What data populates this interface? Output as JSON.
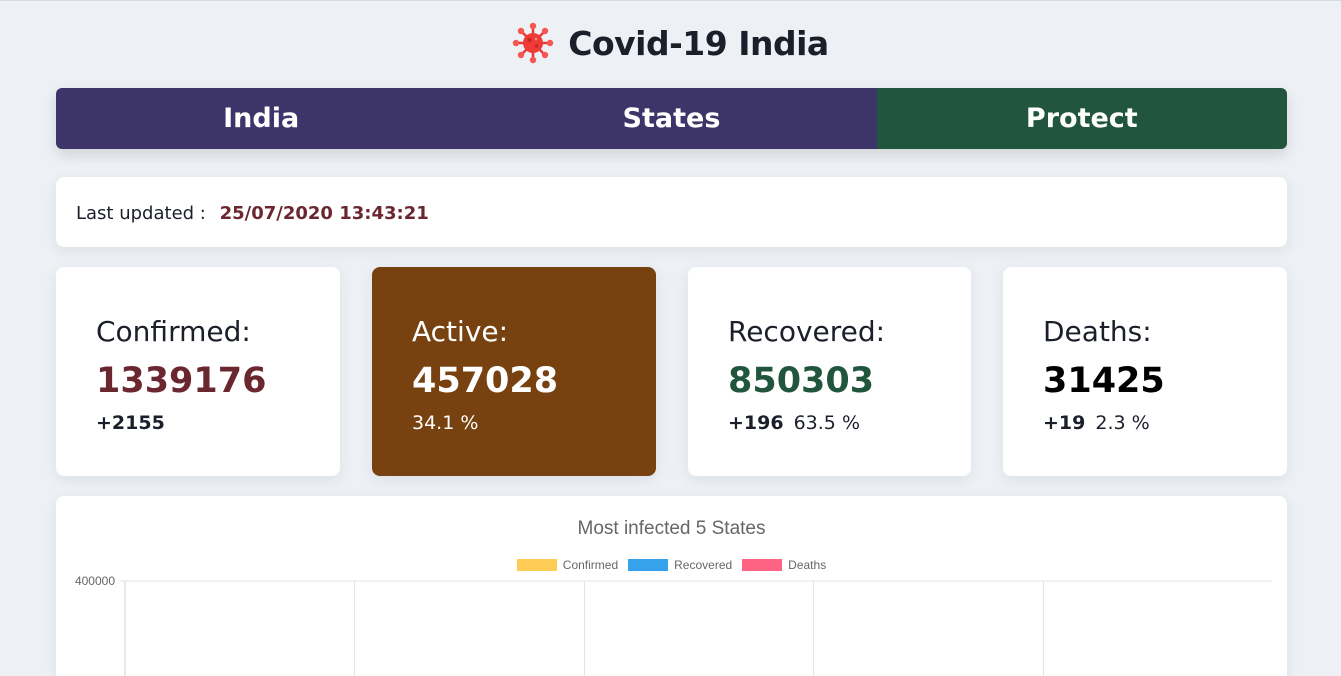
{
  "header": {
    "title": "Covid-19 India",
    "icon": "virus-icon"
  },
  "nav": {
    "tabs": [
      {
        "label": "India",
        "color": "#3d356a"
      },
      {
        "label": "States",
        "color": "#3d356a"
      },
      {
        "label": "Protect",
        "color": "#21553e"
      }
    ]
  },
  "updated": {
    "label": "Last updated :",
    "value": "25/07/2020 13:43:21"
  },
  "stats": {
    "confirmed": {
      "label": "Confirmed:",
      "value": "1339176",
      "delta": "+2155",
      "color": "#6b2730"
    },
    "active": {
      "label": "Active:",
      "value": "457028",
      "percent": "34.1 %",
      "color": "#774210"
    },
    "recovered": {
      "label": "Recovered:",
      "value": "850303",
      "delta": "+196",
      "percent": "63.5 %",
      "color": "#21553e"
    },
    "deaths": {
      "label": "Deaths:",
      "value": "31425",
      "delta": "+19",
      "percent": "2.3 %",
      "color": "#000000"
    }
  },
  "chart": {
    "title": "Most infected 5 States",
    "legend": [
      {
        "label": "Confirmed",
        "color": "#ffcd56"
      },
      {
        "label": "Recovered",
        "color": "#36a2eb"
      },
      {
        "label": "Deaths",
        "color": "#ff6384"
      }
    ],
    "y_ticks": [
      "400000"
    ]
  },
  "chart_data": {
    "type": "bar",
    "title": "Most infected 5 States",
    "series": [
      {
        "name": "Confirmed",
        "values": []
      },
      {
        "name": "Recovered",
        "values": []
      },
      {
        "name": "Deaths",
        "values": []
      }
    ],
    "ylim": [
      0,
      400000
    ],
    "grid": true,
    "legend_position": "top"
  }
}
